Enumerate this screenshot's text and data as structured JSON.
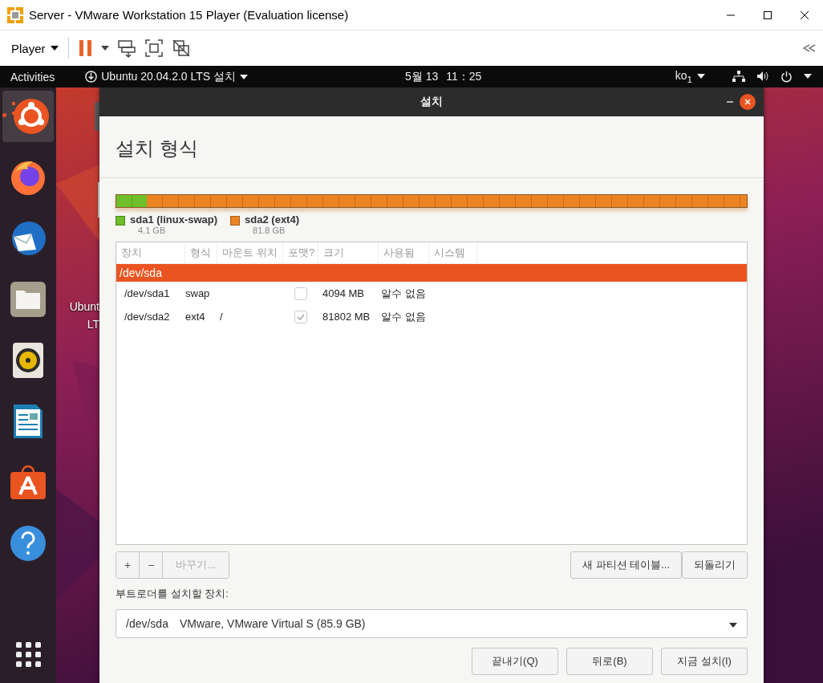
{
  "window": {
    "title": "Server - VMware Workstation 15 Player (Evaluation license)"
  },
  "toolbar": {
    "menu": "Player"
  },
  "topbar": {
    "activities": "Activities",
    "app_menu": "Ubuntu 20.04.2.0 LTS 설치",
    "date": "5월 13",
    "time": "11：25",
    "input_method": "ko$_{1}$"
  },
  "dock": {
    "items": [
      {
        "kind": "ubuntu",
        "selected": true
      },
      {
        "kind": "firefox",
        "selected": false
      },
      {
        "kind": "mail",
        "selected": false
      },
      {
        "kind": "files",
        "selected": false
      },
      {
        "kind": "speaker",
        "selected": false
      },
      {
        "kind": "writer",
        "selected": false
      },
      {
        "kind": "store",
        "selected": false
      },
      {
        "kind": "help",
        "selected": false
      }
    ]
  },
  "desktop": {
    "icons": [
      {
        "label": "Ubunt"
      },
      {
        "label": "LT"
      }
    ]
  },
  "dialog": {
    "title": "설치",
    "heading": "설치 형식",
    "partitions": [
      {
        "name": "sda1 (linux-swap)",
        "size": "4.1 GB",
        "level": 0.048,
        "color": "#6ebf2a"
      },
      {
        "name": "sda2 (ext4)",
        "size": "81.8 GB",
        "level": 0.952,
        "color": "#ec8423"
      }
    ],
    "table": {
      "columns": [
        "장치",
        "형식",
        "마운트 위치",
        "포맷?",
        "크기",
        "사용됨",
        "시스템"
      ],
      "devices": [
        {
          "device": "/dev/sda",
          "selected": true,
          "children": [
            {
              "device": "/dev/sda1",
              "type": "swap",
              "format": false,
              "size": "4094 MB",
              "used": "알수 없음",
              "selected": false
            },
            {
              "device": "/dev/sda2",
              "type": "ext4",
              "mount": "/",
              "format": true,
              "size": "81802 MB",
              "used": "알수 없음",
              "selected": false
            }
          ]
        }
      ]
    },
    "edit_buttons": [
      {
        "kind": "add",
        "label": "+",
        "disabled": false
      },
      {
        "kind": "remove",
        "label": "−",
        "disabled": false
      },
      {
        "kind": "change",
        "label": "바꾸기...",
        "disabled": true
      }
    ],
    "table_buttons": [
      "새 파티션 테이블...",
      "되돌리기"
    ],
    "bootloader": {
      "label": "부트로더를 설치할 장치:",
      "device": "/dev/sda",
      "description": "VMware, VMware Virtual S (85.9 GB)"
    },
    "buttons": [
      "끝내기(Q)",
      "뒤로(B)",
      "지금 설치(I)"
    ]
  }
}
